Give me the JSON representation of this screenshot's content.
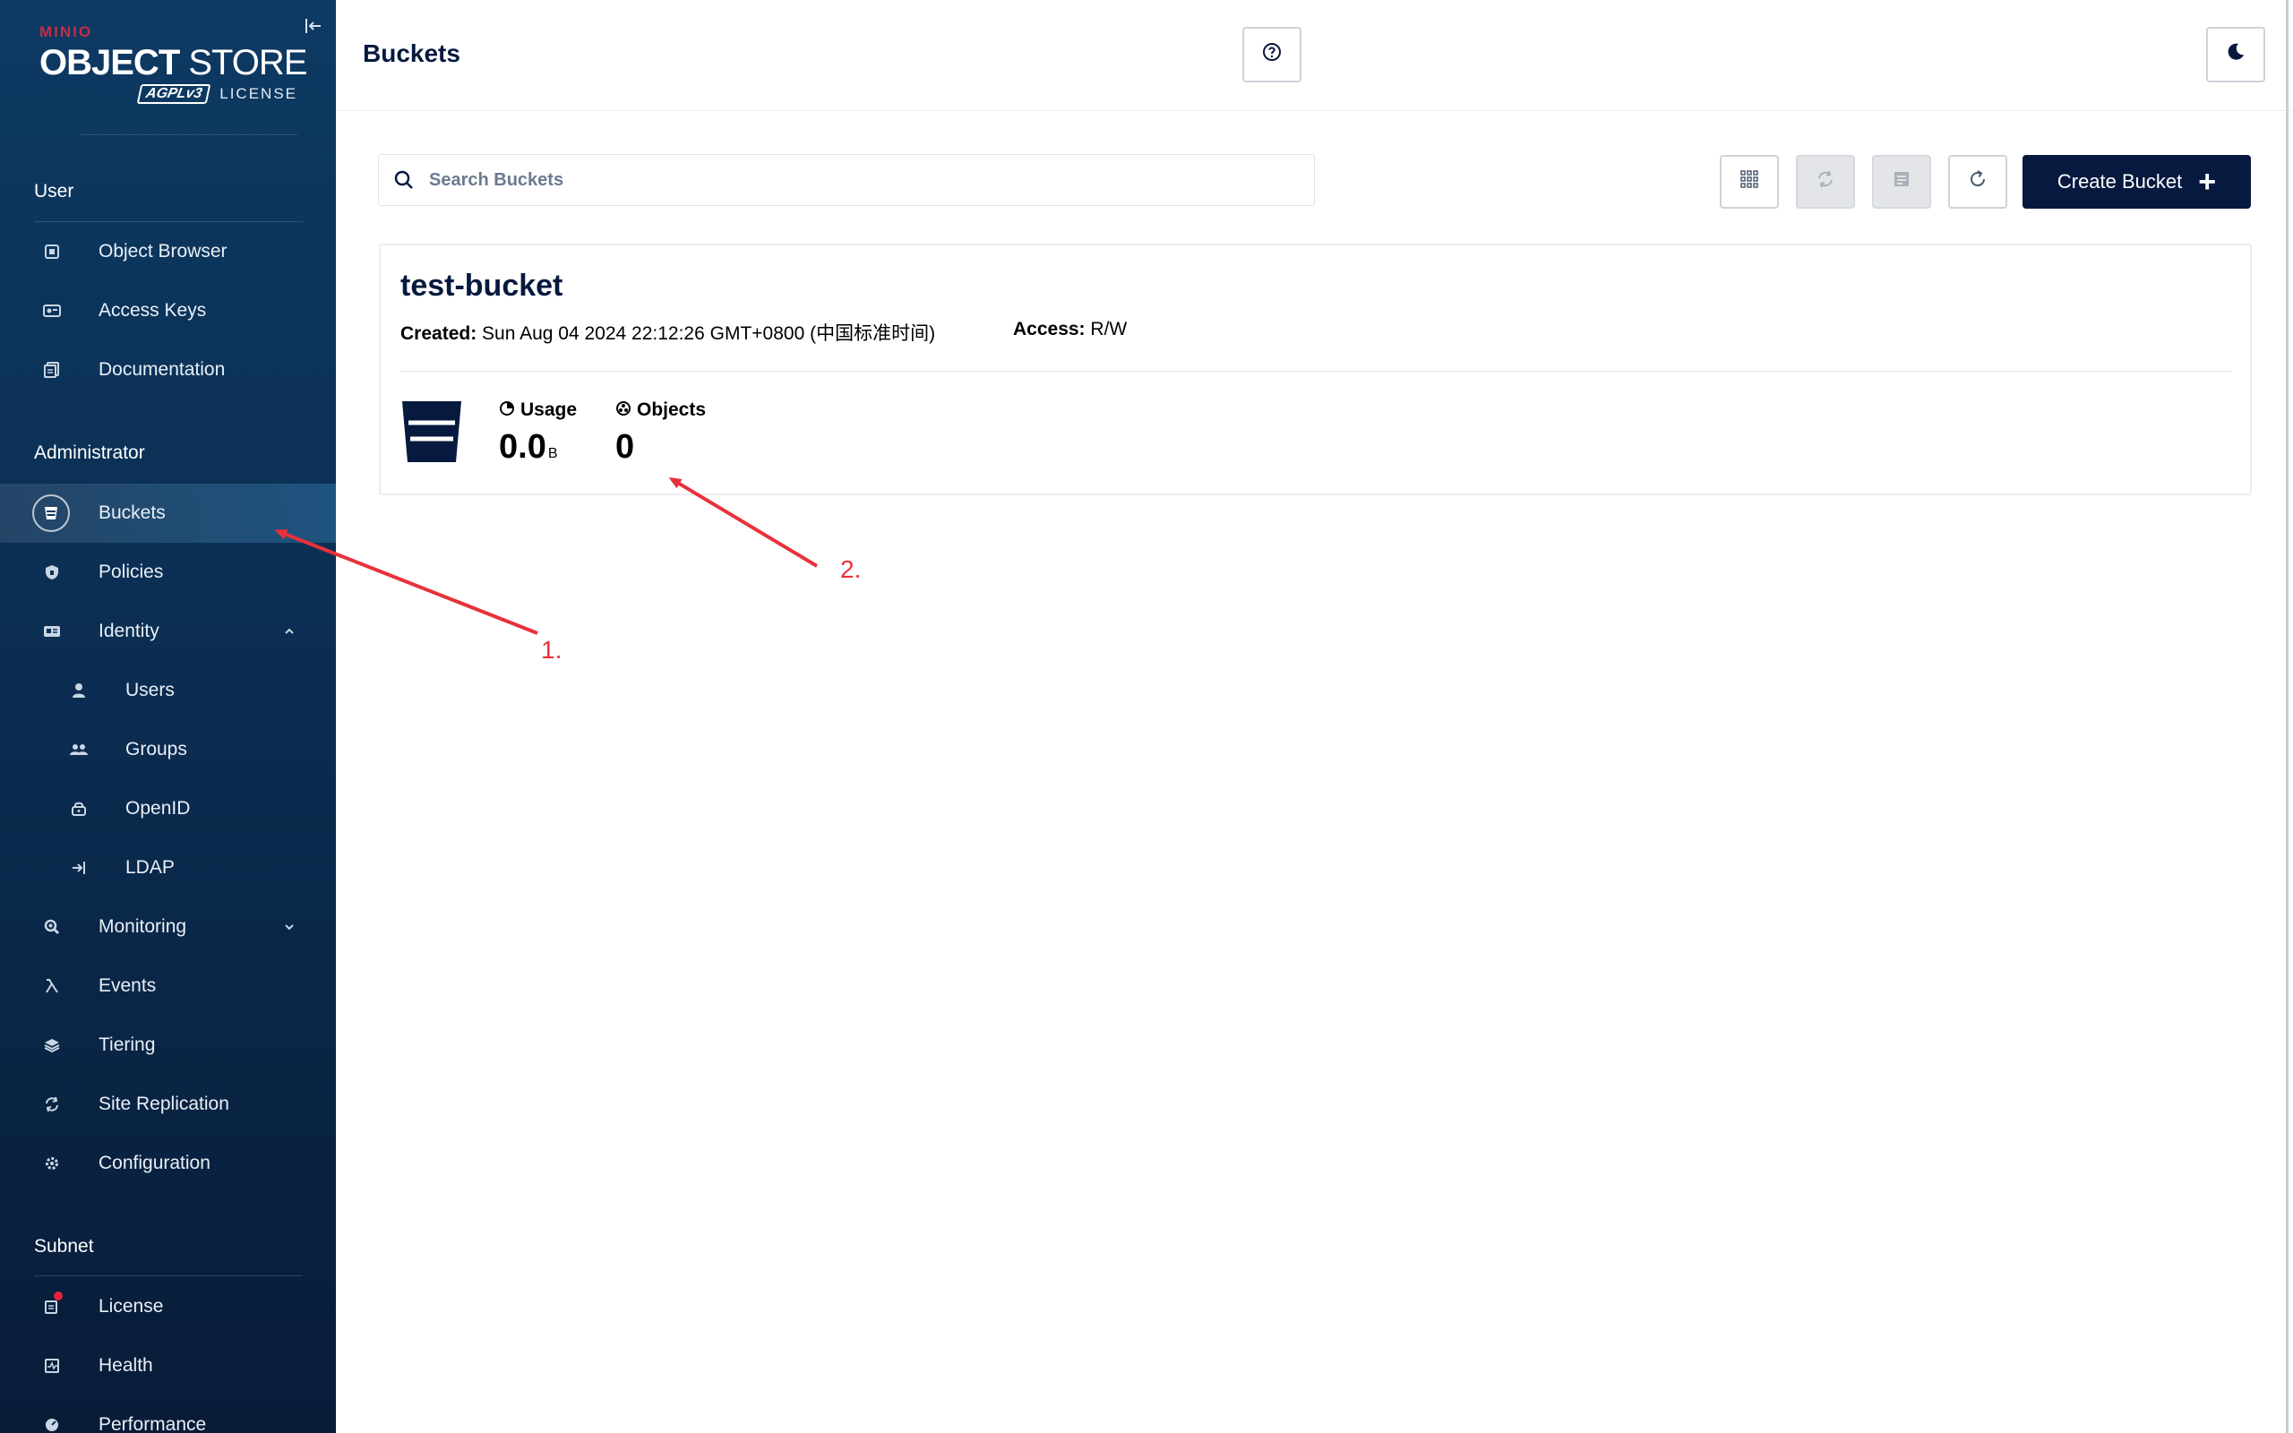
{
  "sidebar": {
    "logo": {
      "brand": "MINIO",
      "title_bold": "OBJECT",
      "title_rest": " STORE",
      "agpl": "AGPLv3",
      "license": "LICENSE"
    },
    "collapse_icon": "collapse-left-icon",
    "sections": {
      "user": "User",
      "administrator": "Administrator",
      "subnet": "Subnet"
    },
    "user_items": [
      {
        "label": "Object Browser",
        "icon": "object-browser-icon"
      },
      {
        "label": "Access Keys",
        "icon": "access-keys-icon"
      },
      {
        "label": "Documentation",
        "icon": "documentation-icon"
      }
    ],
    "admin_items": [
      {
        "label": "Buckets",
        "icon": "bucket-icon",
        "active": true
      },
      {
        "label": "Policies",
        "icon": "policies-icon"
      },
      {
        "label": "Identity",
        "icon": "identity-icon",
        "expanded": true
      },
      {
        "label": "Users",
        "icon": "user-icon"
      },
      {
        "label": "Groups",
        "icon": "groups-icon"
      },
      {
        "label": "OpenID",
        "icon": "openid-icon"
      },
      {
        "label": "LDAP",
        "icon": "ldap-icon"
      },
      {
        "label": "Monitoring",
        "icon": "monitoring-icon"
      },
      {
        "label": "Events",
        "icon": "lambda-icon"
      },
      {
        "label": "Tiering",
        "icon": "tiering-icon"
      },
      {
        "label": "Site Replication",
        "icon": "replication-icon"
      },
      {
        "label": "Configuration",
        "icon": "gear-icon"
      }
    ],
    "subnet_items": [
      {
        "label": "License",
        "icon": "license-icon",
        "badge": true
      },
      {
        "label": "Health",
        "icon": "health-icon"
      },
      {
        "label": "Performance",
        "icon": "performance-icon"
      }
    ]
  },
  "header": {
    "title": "Buckets",
    "help_icon": "help-circle-icon",
    "theme_icon": "moon-icon"
  },
  "toolbar": {
    "search_placeholder": "Search Buckets",
    "create_label": "Create Bucket",
    "icons": [
      "grid-view-icon",
      "replication-icon",
      "lifecycle-icon",
      "refresh-icon"
    ]
  },
  "bucket": {
    "name": "test-bucket",
    "created_label": "Created:",
    "created_value": "Sun Aug 04 2024 22:12:26 GMT+0800 (中国标准时间)",
    "access_label": "Access:",
    "access_value": "R/W",
    "usage_label": "Usage",
    "usage_value": "0.0",
    "usage_unit": "B",
    "objects_label": "Objects",
    "objects_value": "0"
  },
  "annotations": {
    "label_1": "1.",
    "label_2": "2.",
    "color": "#e8313a"
  },
  "colors": {
    "sidebar_bg": "#0b2c50",
    "primary": "#07193e",
    "accent_red": "#c72c48"
  }
}
